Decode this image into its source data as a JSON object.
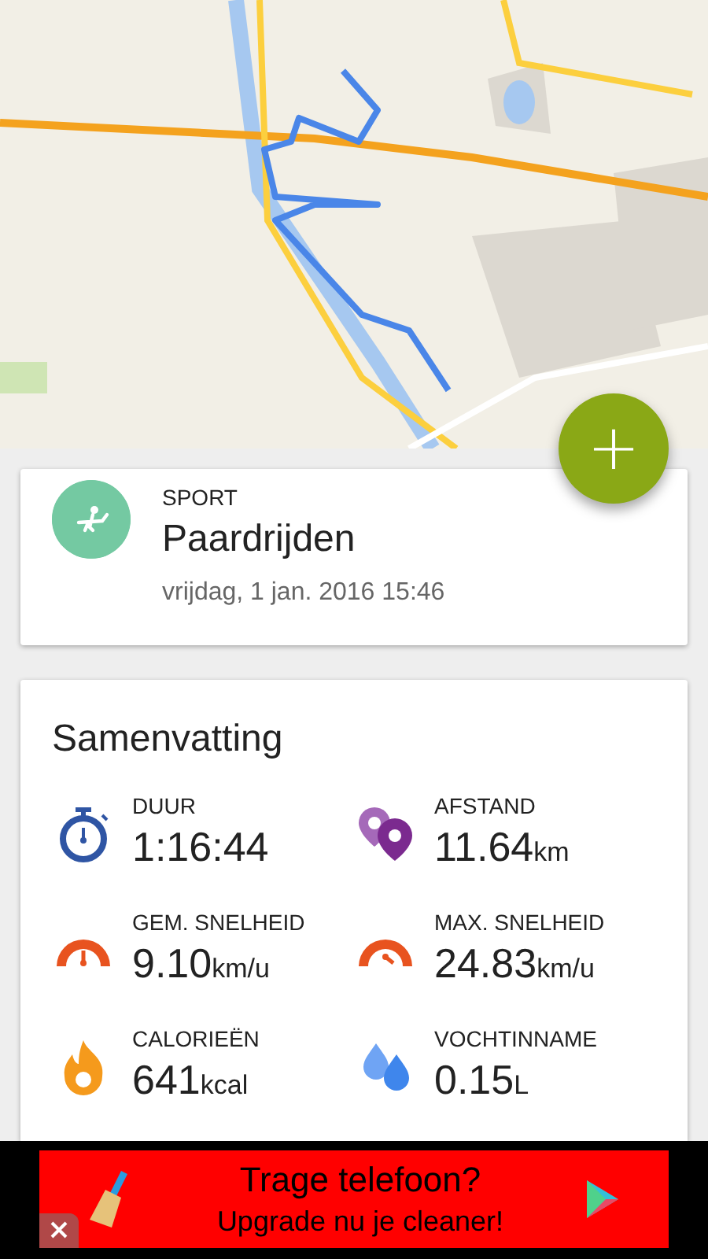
{
  "add_button": {
    "label": "+"
  },
  "activity": {
    "label": "SPORT",
    "sport": "Paardrijden",
    "date": "vrijdag, 1 jan. 2016 15:46"
  },
  "summary": {
    "title": "Samenvatting",
    "stats": [
      {
        "kind": "stopwatch",
        "label": "DUUR",
        "value": "1:16:44"
      },
      {
        "kind": "pins",
        "label": "AFSTAND",
        "value": "11.64",
        "unit": "km"
      },
      {
        "kind": "gauge-low",
        "label": "GEM. SNELHEID",
        "value": "9.10",
        "unit": "km/u"
      },
      {
        "kind": "gauge-high",
        "label": "MAX. SNELHEID",
        "value": "24.83",
        "unit": "km/u"
      },
      {
        "kind": "fire",
        "label": "CALORIEËN",
        "value": "641",
        "unit": "kcal"
      },
      {
        "kind": "drops",
        "label": "VOCHTINNAME",
        "value": "0.15",
        "unit": "L"
      }
    ]
  },
  "ad": {
    "headline": "Trage telefoon?",
    "text": "Upgrade nu je cleaner!"
  }
}
